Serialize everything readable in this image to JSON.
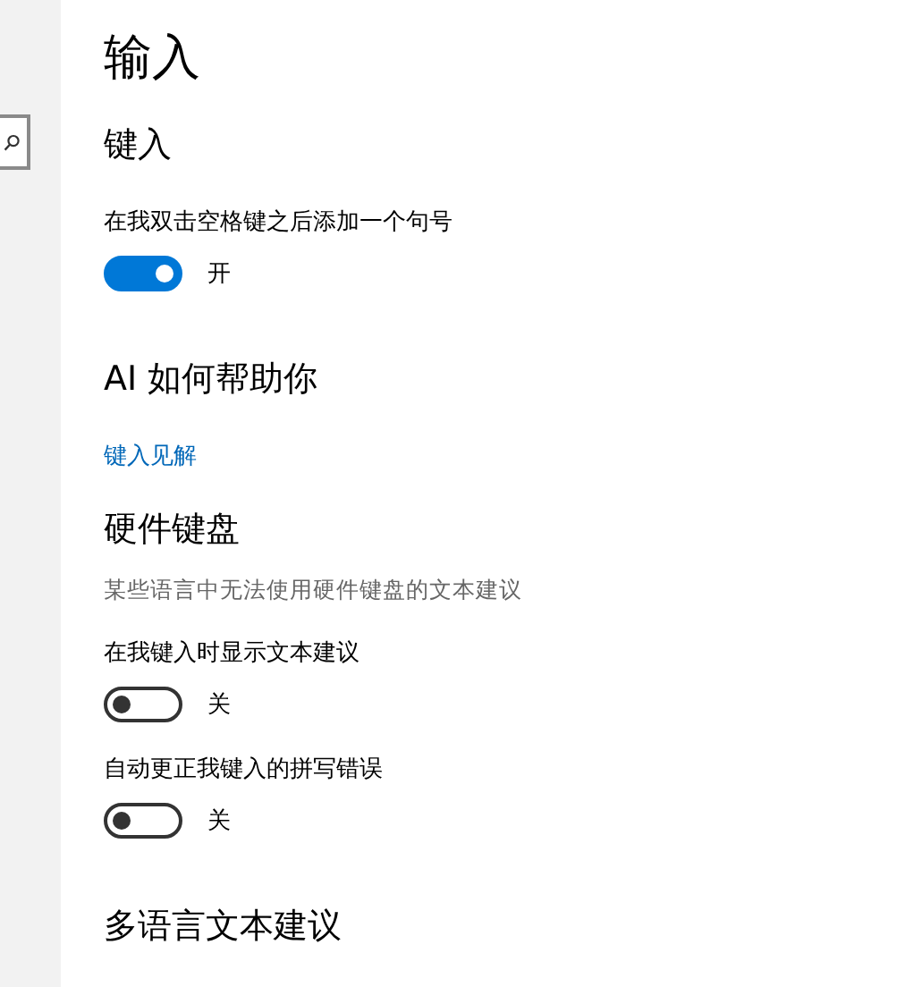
{
  "page_title": "输入",
  "sections": [
    {
      "heading": "键入",
      "items": [
        {
          "kind": "toggle",
          "label": "在我双击空格键之后添加一个句号",
          "on": true,
          "state_text": "开"
        }
      ]
    },
    {
      "heading": "AI 如何帮助你",
      "items": [
        {
          "kind": "link",
          "label": "键入见解"
        }
      ]
    },
    {
      "heading": "硬件键盘",
      "items": [
        {
          "kind": "description",
          "label": "某些语言中无法使用硬件键盘的文本建议"
        },
        {
          "kind": "toggle",
          "label": "在我键入时显示文本建议",
          "on": false,
          "state_text": "关"
        },
        {
          "kind": "toggle",
          "label": "自动更正我键入的拼写错误",
          "on": false,
          "state_text": "关"
        }
      ]
    },
    {
      "heading": "多语言文本建议"
    }
  ]
}
